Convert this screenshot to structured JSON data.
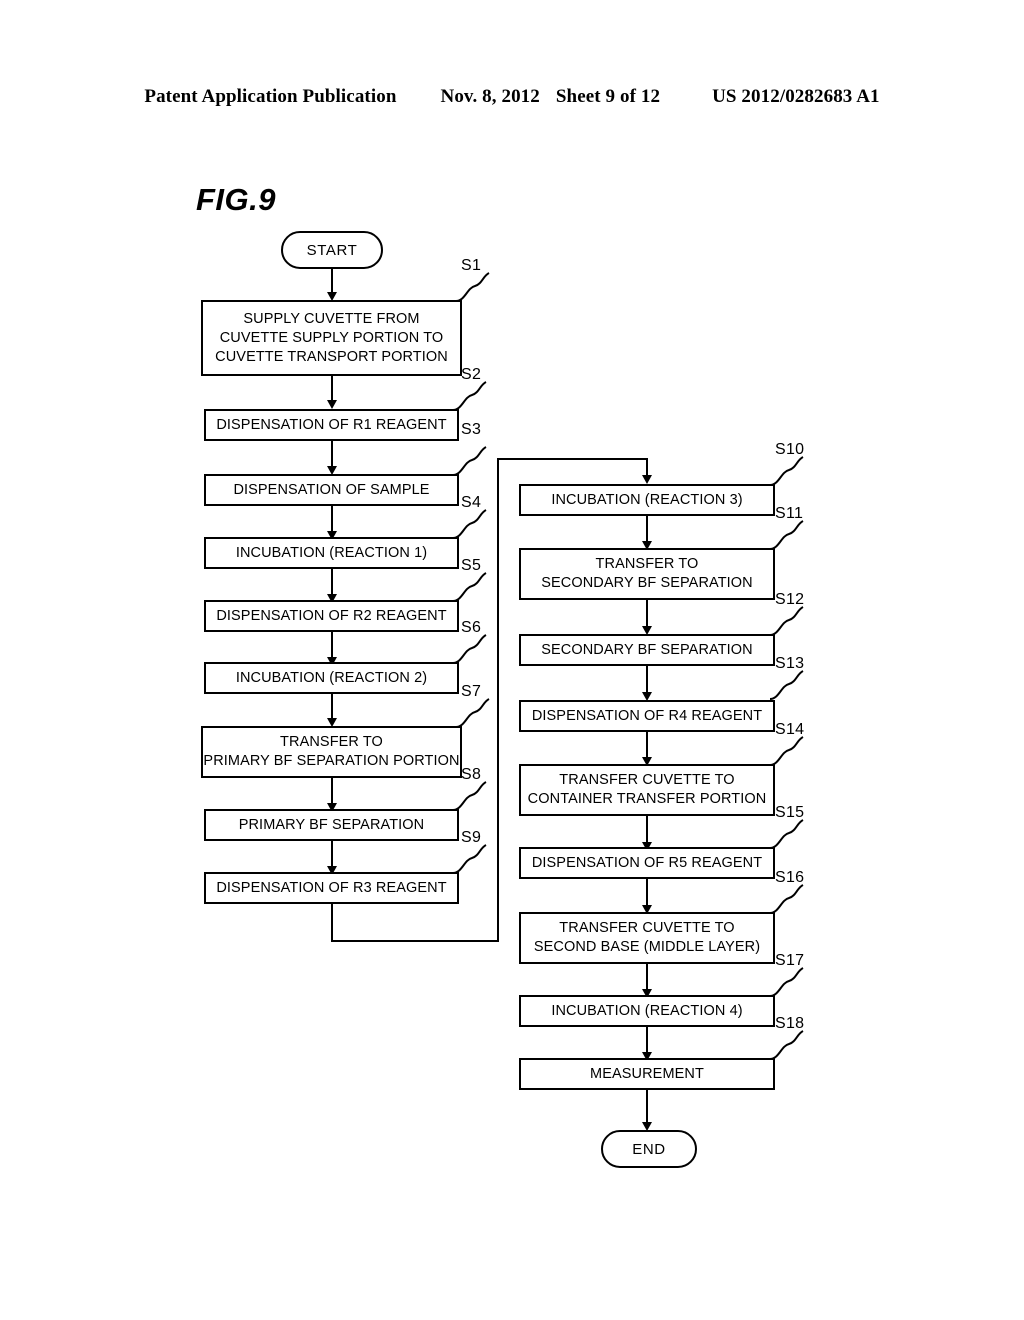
{
  "header": {
    "publication": "Patent Application Publication",
    "date": "Nov. 8, 2012",
    "sheet": "Sheet 9 of 12",
    "patent_number": "US 2012/0282683 A1"
  },
  "figure": {
    "label": "FIG.9"
  },
  "flowchart": {
    "start_label": "START",
    "end_label": "END",
    "left_column": [
      {
        "step": "S1",
        "lines": [
          "SUPPLY CUVETTE FROM",
          "CUVETTE SUPPLY PORTION TO",
          "CUVETTE TRANSPORT PORTION"
        ]
      },
      {
        "step": "S2",
        "lines": [
          "DISPENSATION OF R1 REAGENT"
        ]
      },
      {
        "step": "S3",
        "lines": [
          "DISPENSATION OF SAMPLE"
        ]
      },
      {
        "step": "S4",
        "lines": [
          "INCUBATION (REACTION 1)"
        ]
      },
      {
        "step": "S5",
        "lines": [
          "DISPENSATION OF R2 REAGENT"
        ]
      },
      {
        "step": "S6",
        "lines": [
          "INCUBATION (REACTION 2)"
        ]
      },
      {
        "step": "S7",
        "lines": [
          "TRANSFER TO",
          "PRIMARY BF SEPARATION PORTION"
        ]
      },
      {
        "step": "S8",
        "lines": [
          "PRIMARY BF SEPARATION"
        ]
      },
      {
        "step": "S9",
        "lines": [
          "DISPENSATION OF R3 REAGENT"
        ]
      }
    ],
    "right_column": [
      {
        "step": "S10",
        "lines": [
          "INCUBATION (REACTION 3)"
        ]
      },
      {
        "step": "S11",
        "lines": [
          "TRANSFER TO",
          "SECONDARY BF SEPARATION"
        ]
      },
      {
        "step": "S12",
        "lines": [
          "SECONDARY BF SEPARATION"
        ]
      },
      {
        "step": "S13",
        "lines": [
          "DISPENSATION OF R4 REAGENT"
        ]
      },
      {
        "step": "S14",
        "lines": [
          "TRANSFER CUVETTE TO",
          "CONTAINER TRANSFER PORTION"
        ]
      },
      {
        "step": "S15",
        "lines": [
          "DISPENSATION OF R5 REAGENT"
        ]
      },
      {
        "step": "S16",
        "lines": [
          "TRANSFER CUVETTE TO",
          "SECOND BASE (MIDDLE LAYER)"
        ]
      },
      {
        "step": "S17",
        "lines": [
          "INCUBATION (REACTION 4)"
        ]
      },
      {
        "step": "S18",
        "lines": [
          "MEASUREMENT"
        ]
      }
    ]
  },
  "colors": {
    "ink": "#000000",
    "paper": "#ffffff"
  }
}
